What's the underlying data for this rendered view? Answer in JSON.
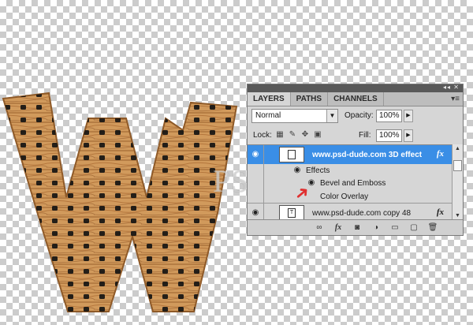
{
  "watermark": "PSDDUDE.COM",
  "panel": {
    "tabs": [
      "LAYERS",
      "PATHS",
      "CHANNELS"
    ],
    "blend_mode": "Normal",
    "opacity_label": "Opacity:",
    "opacity_value": "100%",
    "lock_label": "Lock:",
    "fill_label": "Fill:",
    "fill_value": "100%",
    "layers": [
      {
        "name": "www.psd-dude.com 3D effect",
        "fx": "fx",
        "selected": true
      },
      {
        "name": "www.psd-dude.com copy 48",
        "fx": "fx",
        "selected": false
      }
    ],
    "effects_label": "Effects",
    "effects": [
      "Bevel and Emboss",
      "Color Overlay"
    ]
  },
  "colors": {
    "selection": "#3a8ee6",
    "wood": "#c98b4a",
    "arrow": "#e03030"
  }
}
